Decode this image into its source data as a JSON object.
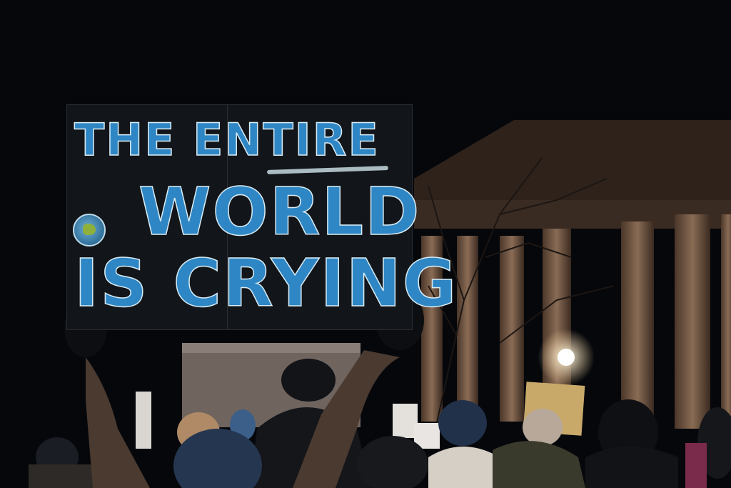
{
  "sign": {
    "line1": "THE ENTIRE",
    "line2": "WORLD",
    "line3": "IS CRYING",
    "text_color": "#2f86c4",
    "outline_color": "#d8ecf5",
    "board_color": "#121519"
  },
  "scene": {
    "sky_color": "#05070b",
    "building_color": "#3c2c22",
    "lamp_color": "#ffffff"
  },
  "icons": {
    "earth": "earth-icon"
  }
}
